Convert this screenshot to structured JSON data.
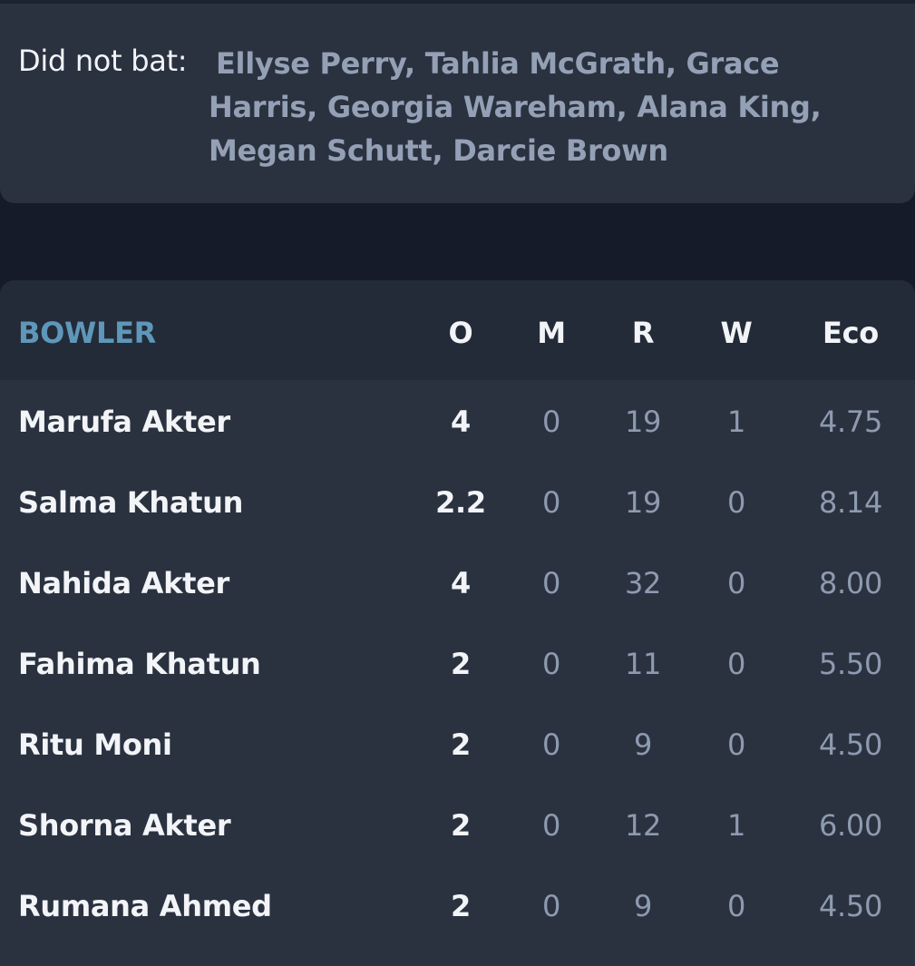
{
  "did_not_bat": {
    "label": "Did not bat:",
    "names": "Ellyse Perry, Tahlia McGrath, Grace Harris, Georgia Wareham, Alana King, Megan Schutt, Darcie Brown"
  },
  "bowling": {
    "headers": {
      "bowler": "BOWLER",
      "overs": "O",
      "maidens": "M",
      "runs": "R",
      "wickets": "W",
      "economy": "Eco"
    },
    "rows": [
      {
        "name": "Marufa Akter",
        "o": "4",
        "m": "0",
        "r": "19",
        "w": "1",
        "eco": "4.75"
      },
      {
        "name": "Salma Khatun",
        "o": "2.2",
        "m": "0",
        "r": "19",
        "w": "0",
        "eco": "8.14"
      },
      {
        "name": "Nahida Akter",
        "o": "4",
        "m": "0",
        "r": "32",
        "w": "0",
        "eco": "8.00"
      },
      {
        "name": "Fahima Khatun",
        "o": "2",
        "m": "0",
        "r": "11",
        "w": "0",
        "eco": "5.50"
      },
      {
        "name": "Ritu Moni",
        "o": "2",
        "m": "0",
        "r": "9",
        "w": "0",
        "eco": "4.50"
      },
      {
        "name": "Shorna Akter",
        "o": "2",
        "m": "0",
        "r": "12",
        "w": "1",
        "eco": "6.00"
      },
      {
        "name": "Rumana Ahmed",
        "o": "2",
        "m": "0",
        "r": "9",
        "w": "0",
        "eco": "4.50"
      }
    ]
  },
  "colors": {
    "page_background": "#151b28",
    "card_background": "#2a3240",
    "header_background": "#242b38",
    "accent_header": "#5e97b9",
    "primary_text": "#f2f4f7",
    "secondary_text": "#8e9ab0"
  }
}
